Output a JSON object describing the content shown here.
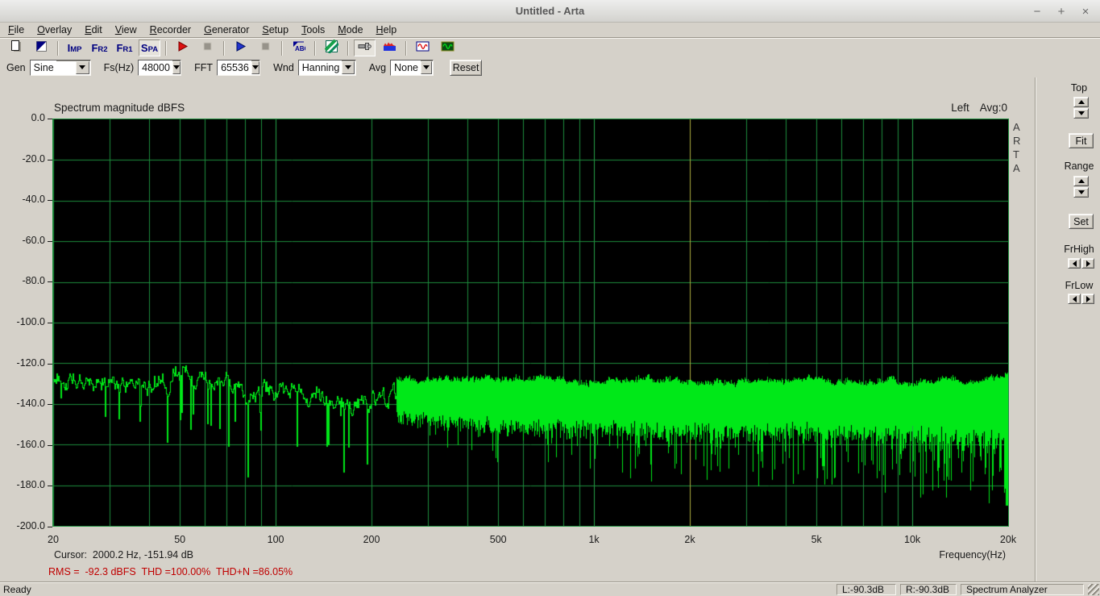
{
  "window": {
    "title": "Untitled - Arta",
    "minimize": "−",
    "maximize": "+",
    "close": "×"
  },
  "menu": {
    "items": [
      "File",
      "Overlay",
      "Edit",
      "View",
      "Recorder",
      "Generator",
      "Setup",
      "Tools",
      "Mode",
      "Help"
    ]
  },
  "toolbar": {
    "buttons": [
      {
        "name": "new-file-button",
        "icon": "new-file"
      },
      {
        "name": "overlay-button",
        "icon": "overlay"
      },
      {
        "sep": true
      },
      {
        "name": "impedance-mode-button",
        "icon": "mode-text",
        "big": "I",
        "small": "MP"
      },
      {
        "name": "fr2-mode-button",
        "icon": "mode-text",
        "big": "F",
        "small": "R2"
      },
      {
        "name": "fr1-mode-button",
        "icon": "mode-text",
        "big": "F",
        "small": "R1"
      },
      {
        "name": "spectrum-mode-button",
        "icon": "mode-text",
        "big": "S",
        "small": "PA",
        "pressed": true
      },
      {
        "sep": true
      },
      {
        "name": "record-start-button",
        "icon": "play-red"
      },
      {
        "name": "record-stop-button",
        "icon": "stop-gray",
        "disabled": true
      },
      {
        "sep": true
      },
      {
        "name": "generator-start-button",
        "icon": "play-blue"
      },
      {
        "name": "generator-stop-button",
        "icon": "stop-gray",
        "disabled": true
      },
      {
        "sep": true
      },
      {
        "name": "calibrate-abc-button",
        "icon": "abc"
      },
      {
        "sep": true
      },
      {
        "name": "scale-button",
        "icon": "diag-green"
      },
      {
        "sep": true
      },
      {
        "name": "cursor-marker-button",
        "icon": "flashlight",
        "pressed": true
      },
      {
        "name": "spectrum-view-button",
        "icon": "mountain"
      },
      {
        "sep": true
      },
      {
        "name": "signal-red-button",
        "icon": "sine-red"
      },
      {
        "name": "signal-green-button",
        "icon": "sine-green"
      }
    ]
  },
  "controls_bar": {
    "gen_label": "Gen",
    "gen_value": "Sine",
    "fs_label": "Fs(Hz)",
    "fs_value": "48000",
    "fft_label": "FFT",
    "fft_value": "65536",
    "wnd_label": "Wnd",
    "wnd_value": "Hanning",
    "avg_label": "Avg",
    "avg_value": "None",
    "reset_label": "Reset"
  },
  "side_panel": {
    "top_label": "Top",
    "fit_label": "Fit",
    "range_label": "Range",
    "set_label": "Set",
    "frhigh_label": "FrHigh",
    "frlow_label": "FrLow"
  },
  "plot": {
    "title": "Spectrum magnitude dBFS",
    "channel": "Left",
    "avg_info": "Avg:0",
    "watermark": [
      "A",
      "R",
      "T",
      "A"
    ],
    "xlabel": "Frequency(Hz)",
    "cursor_readout": "Cursor:  2000.2 Hz, -151.94 dB",
    "rms_readout": "RMS =  -92.3 dBFS  THD =100.00%  THD+N =86.05%"
  },
  "chart_data": {
    "type": "line",
    "title": "Spectrum magnitude dBFS",
    "xlabel": "Frequency(Hz)",
    "ylabel": "dBFS",
    "x_scale": "log",
    "x_range_hz": [
      20,
      20000
    ],
    "y_range_db": [
      -200,
      0
    ],
    "x_ticks": [
      {
        "label": "20",
        "hz": 20
      },
      {
        "label": "50",
        "hz": 50
      },
      {
        "label": "100",
        "hz": 100
      },
      {
        "label": "200",
        "hz": 200
      },
      {
        "label": "500",
        "hz": 500
      },
      {
        "label": "1k",
        "hz": 1000
      },
      {
        "label": "2k",
        "hz": 2000
      },
      {
        "label": "5k",
        "hz": 5000
      },
      {
        "label": "10k",
        "hz": 10000
      },
      {
        "label": "20k",
        "hz": 20000
      }
    ],
    "y_ticks": [
      "0.0",
      "-20.0",
      "-40.0",
      "-60.0",
      "-80.0",
      "-100.0",
      "-120.0",
      "-140.0",
      "-160.0",
      "-180.0",
      "-200.0"
    ],
    "grid": true,
    "legend": "none",
    "colors": {
      "background": "#000000",
      "grid": "#1d8c3c",
      "grid_decade": "#27a449",
      "trace": "#00e818",
      "cursor_line": "#b0b040"
    },
    "cursor": {
      "freq_hz": 2000.2,
      "level_db": -151.94
    },
    "readouts": {
      "rms_dbfs": -92.3,
      "thd_percent": 100.0,
      "thd_n_percent": 86.05,
      "channel": "Left",
      "averages": 0
    },
    "series": [
      {
        "name": "Left channel noise spectrum",
        "color": "#00e818",
        "envelope": {
          "freq_hz": [
            20,
            30,
            45,
            49,
            51,
            55,
            100,
            200,
            350,
            500,
            1000,
            2000,
            5000,
            10000,
            20000
          ],
          "top_db": [
            -121,
            -126,
            -125,
            -117,
            -120,
            -126,
            -127,
            -128,
            -128,
            -128,
            -128,
            -129,
            -129,
            -129,
            -127
          ],
          "body_bottom_db": [
            -132,
            -134,
            -134,
            -130,
            -132,
            -135,
            -141,
            -144,
            -147,
            -150,
            -151,
            -152,
            -152,
            -153,
            -156
          ],
          "spike_floor_db": [
            -134,
            -138,
            -150,
            -140,
            -142,
            -152,
            -160,
            -163,
            -168,
            -172,
            -176,
            -181,
            -183,
            -186,
            -190
          ]
        }
      }
    ]
  },
  "status_bar": {
    "ready": "Ready",
    "left_level": "L:-90.3dB",
    "right_level": "R:-90.3dB",
    "mode": "Spectrum Analyzer"
  }
}
